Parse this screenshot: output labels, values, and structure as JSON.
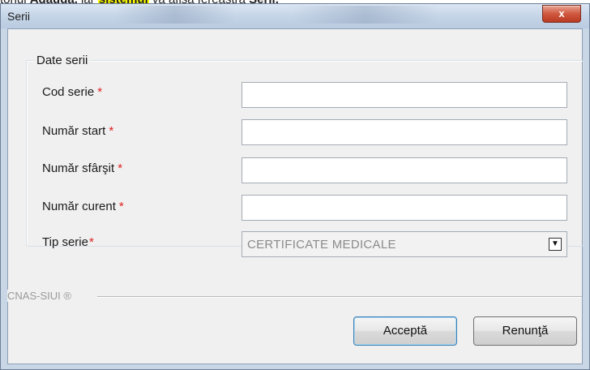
{
  "doc_snippet": {
    "prefix": "tonul ",
    "bold1": "Adaugă,",
    "middle": " iar ",
    "highlight": "sistemul",
    "suffix": " va afişa fereastra ",
    "bold2": "Serii."
  },
  "window": {
    "title": "Serii",
    "close_label": "x"
  },
  "group": {
    "legend": "Date serii"
  },
  "fields": [
    {
      "label": "Cod serie",
      "required_mark": "*",
      "value": ""
    },
    {
      "label": "Număr start",
      "required_mark": "*",
      "value": ""
    },
    {
      "label": "Număr sfârşit",
      "required_mark": "*",
      "value": ""
    },
    {
      "label": "Număr curent",
      "required_mark": "*",
      "value": ""
    }
  ],
  "tip_serie": {
    "label": "Tip serie",
    "required_mark": "*",
    "selected": "CERTIFICATE MEDICALE"
  },
  "footer": {
    "brand": "CNAS-SIUI ®"
  },
  "buttons": {
    "accept": "Acceptă",
    "cancel": "Renunţă"
  },
  "colors": {
    "required": "#e02020",
    "highlight": "#ffff00",
    "close": "#c8442c"
  }
}
